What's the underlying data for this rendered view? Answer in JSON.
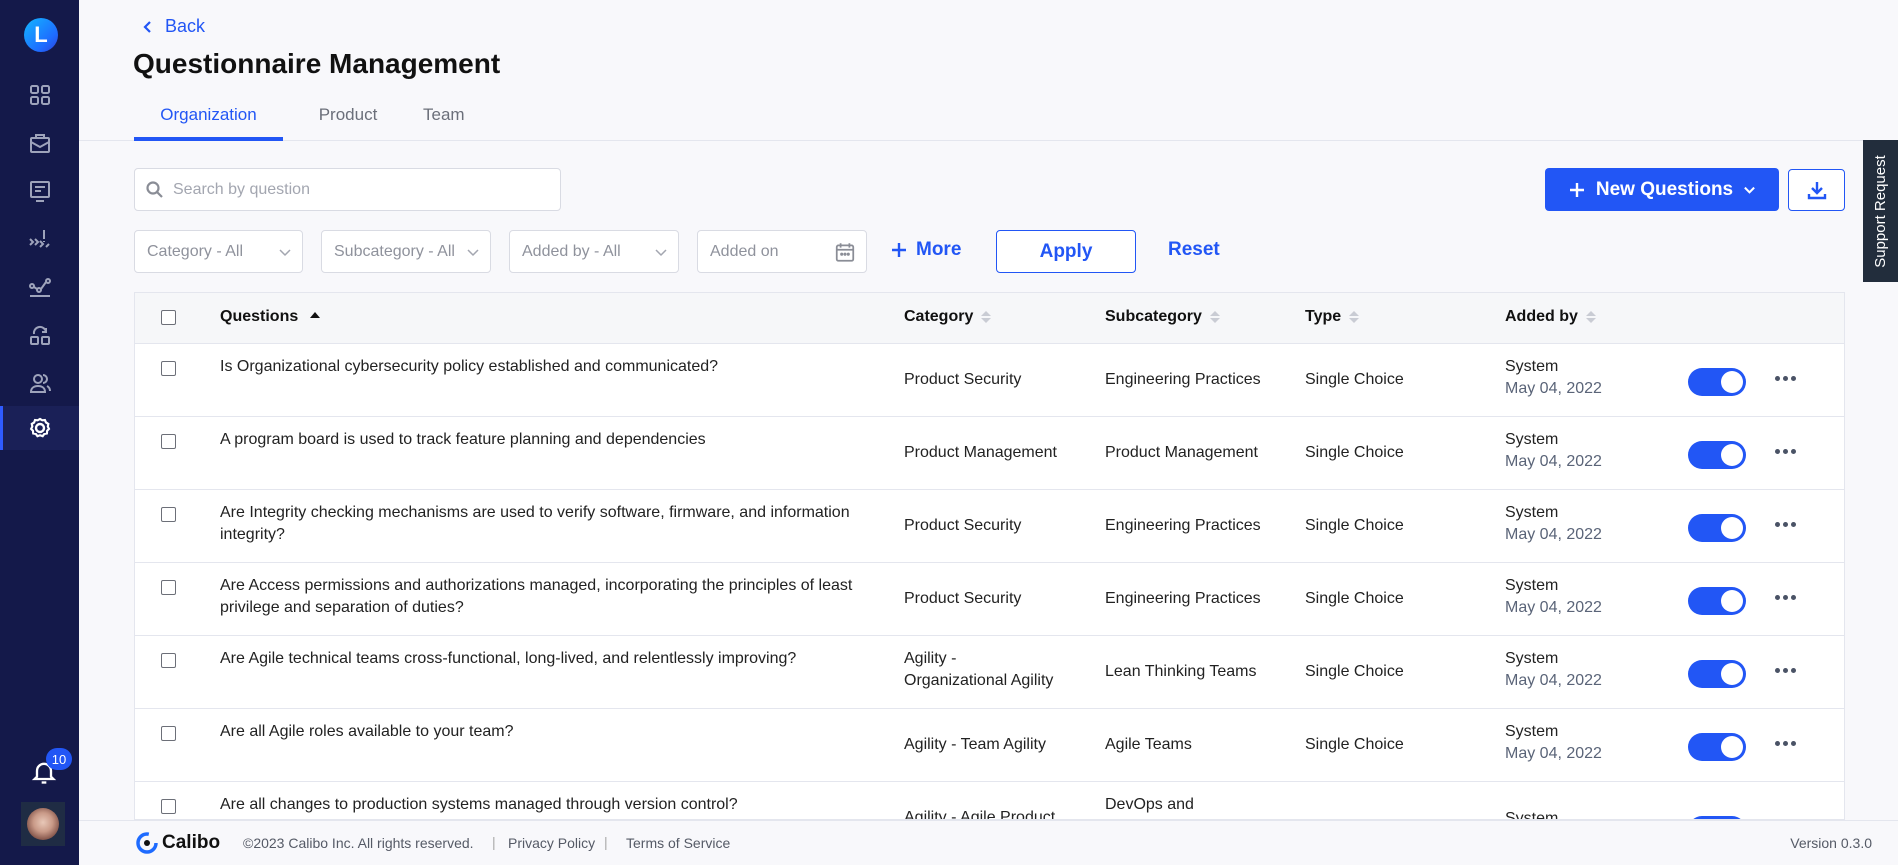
{
  "sidebar": {
    "logo_letter": "L",
    "nav": [
      {
        "name": "dashboard",
        "icon": "grid-icon",
        "active": false
      },
      {
        "name": "portfolio",
        "icon": "briefcase-icon",
        "active": false
      },
      {
        "name": "presentation",
        "icon": "presentation-icon",
        "active": false
      },
      {
        "name": "risks",
        "icon": "road-warning-icon",
        "active": false
      },
      {
        "name": "analytics",
        "icon": "line-graph-icon",
        "active": false
      },
      {
        "name": "workflow",
        "icon": "cycle-blocks-icon",
        "active": false
      },
      {
        "name": "users",
        "icon": "users-icon",
        "active": false
      },
      {
        "name": "settings",
        "icon": "gear-icon",
        "active": true
      }
    ],
    "notifications_count": "10"
  },
  "header": {
    "back_label": "Back",
    "title": "Questionnaire Management",
    "tabs": [
      {
        "label": "Organization",
        "active": true
      },
      {
        "label": "Product",
        "active": false
      },
      {
        "label": "Team",
        "active": false
      }
    ]
  },
  "toolbar": {
    "search_placeholder": "Search by question",
    "search_value": "",
    "filters": {
      "category": "Category - All",
      "subcategory": "Subcategory - All",
      "added_by": "Added by - All",
      "added_on_placeholder": "Added on"
    },
    "more_label": "More",
    "apply_label": "Apply",
    "reset_label": "Reset",
    "new_questions_label": "New Questions"
  },
  "support_label": "Support Request",
  "table": {
    "columns": {
      "questions": "Questions",
      "category": "Category",
      "subcategory": "Subcategory",
      "type": "Type",
      "added_by": "Added by"
    },
    "rows": [
      {
        "question": "Is Organizational cybersecurity policy established and communicated?",
        "category": "Product Security",
        "subcategory": "Engineering Practices",
        "type": "Single Choice",
        "added_by": "System",
        "added_on": "May 04, 2022",
        "enabled": true
      },
      {
        "question": "A program board is used to track feature planning and dependencies",
        "category": "Product Management",
        "subcategory": "Product Management",
        "type": "Single Choice",
        "added_by": "System",
        "added_on": "May 04, 2022",
        "enabled": true
      },
      {
        "question": "Are Integrity checking mechanisms are used to verify software, firmware, and information integrity?",
        "category": "Product Security",
        "subcategory": "Engineering Practices",
        "type": "Single Choice",
        "added_by": "System",
        "added_on": "May 04, 2022",
        "enabled": true
      },
      {
        "question": "Are Access permissions and authorizations managed, incorporating the principles of least privilege and separation of duties?",
        "category": "Product Security",
        "subcategory": "Engineering Practices",
        "type": "Single Choice",
        "added_by": "System",
        "added_on": "May 04, 2022",
        "enabled": true
      },
      {
        "question": "Are Agile technical teams cross-functional, long-lived, and relentlessly improving?",
        "category": "Agility - Organizational Agility",
        "subcategory": "Lean Thinking Teams",
        "type": "Single Choice",
        "added_by": "System",
        "added_on": "May 04, 2022",
        "enabled": true
      },
      {
        "question": "Are all Agile roles available to your team?",
        "category": "Agility - Team Agility",
        "subcategory": "Agile Teams",
        "type": "Single Choice",
        "added_by": "System",
        "added_on": "May 04, 2022",
        "enabled": true
      },
      {
        "question": "Are all changes to production systems managed through version control?",
        "category": "Agility - Agile Product",
        "subcategory": "DevOps and",
        "type": "",
        "added_by": "System",
        "added_on": "",
        "enabled": true
      }
    ]
  },
  "footer": {
    "brand": "Calibo",
    "copyright": "©2023 Calibo Inc. All rights reserved.",
    "privacy_label": "Privacy Policy",
    "terms_label": "Terms of Service",
    "version": "Version 0.3.0"
  },
  "colors": {
    "primary": "#2256f5",
    "sidebar_bg": "#14194a",
    "support_bg": "#222d3c"
  }
}
